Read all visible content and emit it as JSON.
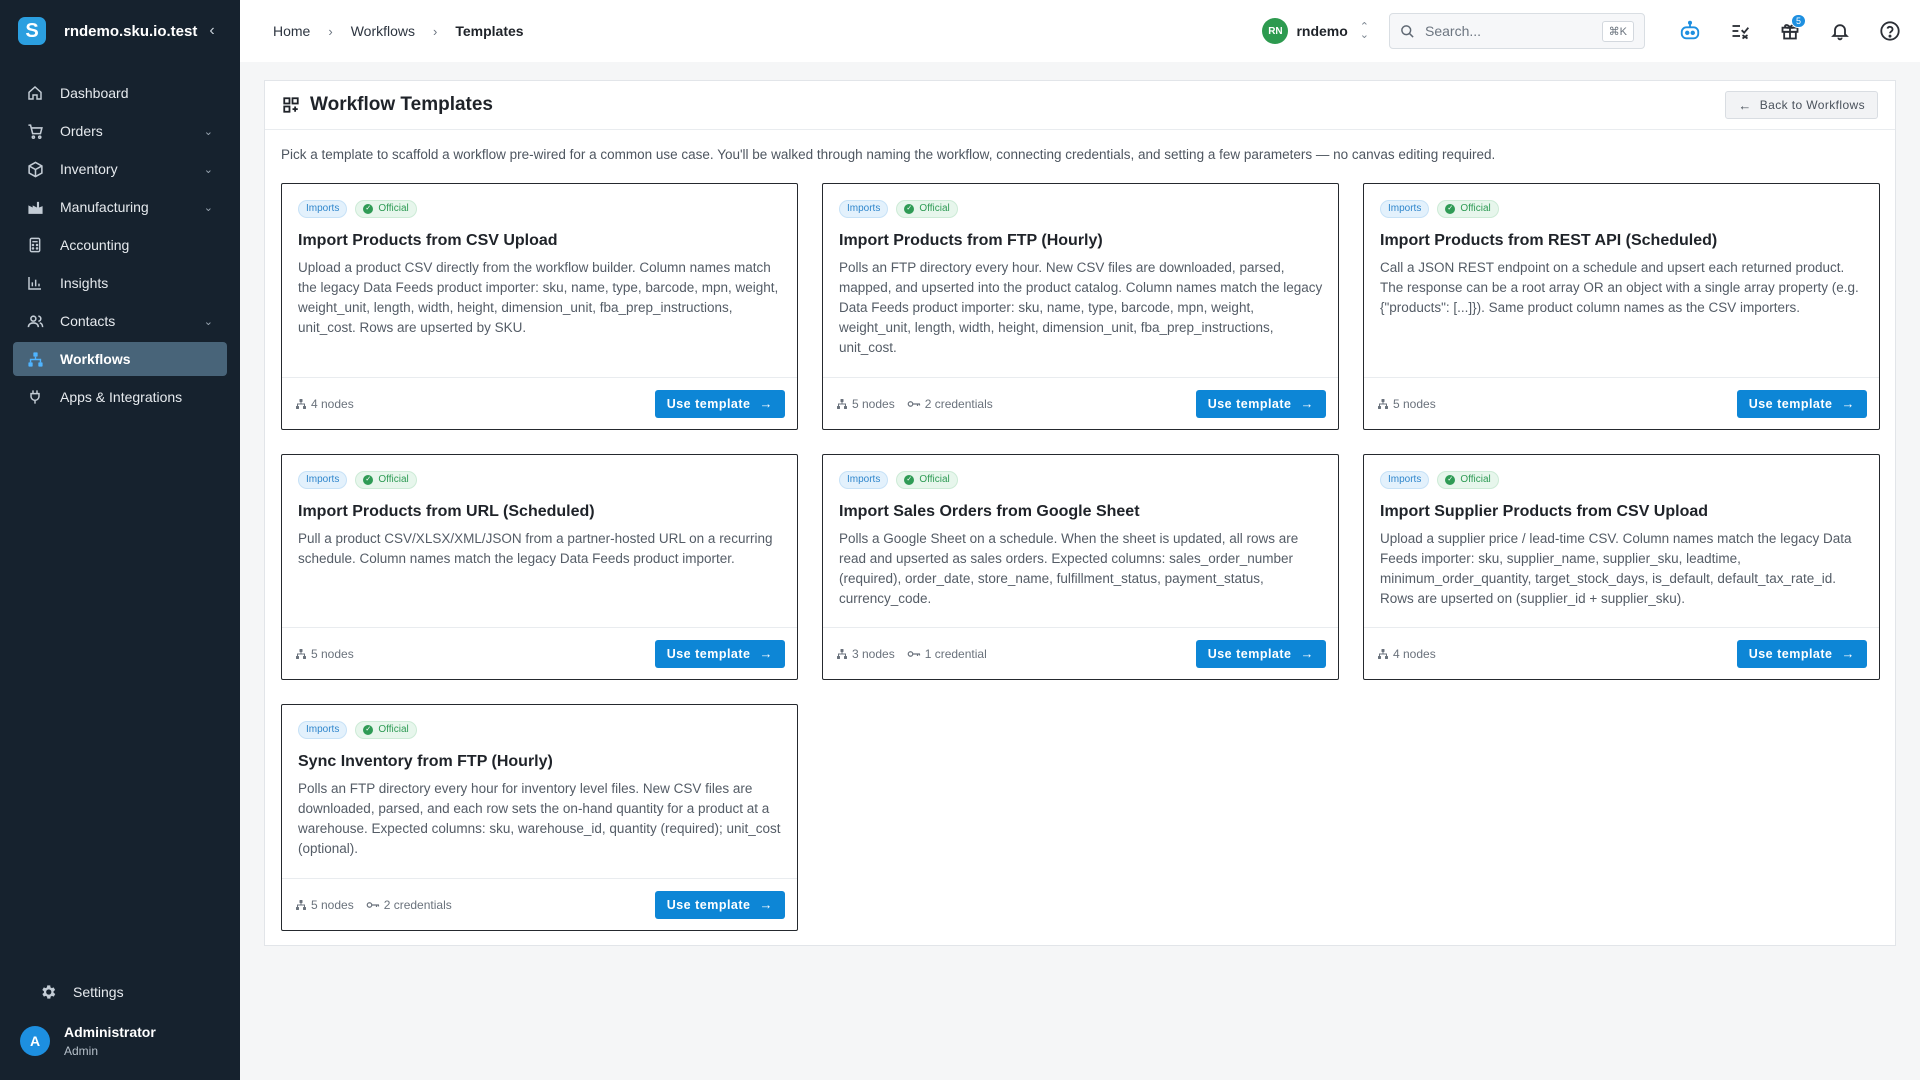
{
  "brand": {
    "logo_letter": "S",
    "name": "rndemo.sku.io.test",
    "collapse_glyph": "‹"
  },
  "sidebar": {
    "items": [
      {
        "label": "Dashboard",
        "icon": "home-icon",
        "expandable": false,
        "active": false
      },
      {
        "label": "Orders",
        "icon": "cart-icon",
        "expandable": true,
        "active": false
      },
      {
        "label": "Inventory",
        "icon": "box-icon",
        "expandable": true,
        "active": false
      },
      {
        "label": "Manufacturing",
        "icon": "factory-icon",
        "expandable": true,
        "active": false
      },
      {
        "label": "Accounting",
        "icon": "calculator-icon",
        "expandable": false,
        "active": false
      },
      {
        "label": "Insights",
        "icon": "chart-icon",
        "expandable": false,
        "active": false
      },
      {
        "label": "Contacts",
        "icon": "users-icon",
        "expandable": true,
        "active": false
      },
      {
        "label": "Workflows",
        "icon": "workflow-icon",
        "expandable": false,
        "active": true
      },
      {
        "label": "Apps & Integrations",
        "icon": "plug-icon",
        "expandable": false,
        "active": false
      }
    ],
    "settings_label": "Settings",
    "user": {
      "initial": "A",
      "name": "Administrator",
      "role": "Admin"
    }
  },
  "breadcrumb": {
    "home": "Home",
    "workflows": "Workflows",
    "current": "Templates"
  },
  "topbar": {
    "org": {
      "initials": "RN",
      "name": "rndemo"
    },
    "search": {
      "placeholder": "Search...",
      "shortcut": "⌘K"
    },
    "gift_badge": "5"
  },
  "page": {
    "title": "Workflow Templates",
    "back_label": "Back to Workflows",
    "intro": "Pick a template to scaffold a workflow pre-wired for a common use case. You'll be walked through naming the workflow, connecting credentials, and setting a few parameters — no canvas editing required.",
    "use_label": "Use template"
  },
  "templates": [
    {
      "category": "Imports",
      "official": "Official",
      "title": "Import Products from CSV Upload",
      "description": "Upload a product CSV directly from the workflow builder. Column names match the legacy Data Feeds product importer: sku, name, type, barcode, mpn, weight, weight_unit, length, width, height, dimension_unit, fba_prep_instructions, unit_cost. Rows are upserted by SKU.",
      "nodes": "4 nodes",
      "credentials": ""
    },
    {
      "category": "Imports",
      "official": "Official",
      "title": "Import Products from FTP (Hourly)",
      "description": "Polls an FTP directory every hour. New CSV files are downloaded, parsed, mapped, and upserted into the product catalog. Column names match the legacy Data Feeds product importer: sku, name, type, barcode, mpn, weight, weight_unit, length, width, height, dimension_unit, fba_prep_instructions, unit_cost.",
      "nodes": "5 nodes",
      "credentials": "2 credentials"
    },
    {
      "category": "Imports",
      "official": "Official",
      "title": "Import Products from REST API (Scheduled)",
      "description": "Call a JSON REST endpoint on a schedule and upsert each returned product. The response can be a root array OR an object with a single array property (e.g. {\"products\": [...]}). Same product column names as the CSV importers.",
      "nodes": "5 nodes",
      "credentials": ""
    },
    {
      "category": "Imports",
      "official": "Official",
      "title": "Import Products from URL (Scheduled)",
      "description": "Pull a product CSV/XLSX/XML/JSON from a partner-hosted URL on a recurring schedule. Column names match the legacy Data Feeds product importer.",
      "nodes": "5 nodes",
      "credentials": ""
    },
    {
      "category": "Imports",
      "official": "Official",
      "title": "Import Sales Orders from Google Sheet",
      "description": "Polls a Google Sheet on a schedule. When the sheet is updated, all rows are read and upserted as sales orders. Expected columns: sales_order_number (required), order_date, store_name, fulfillment_status, payment_status, currency_code.",
      "nodes": "3 nodes",
      "credentials": "1 credential"
    },
    {
      "category": "Imports",
      "official": "Official",
      "title": "Import Supplier Products from CSV Upload",
      "description": "Upload a supplier price / lead-time CSV. Column names match the legacy Data Feeds importer: sku, supplier_name, supplier_sku, leadtime, minimum_order_quantity, target_stock_days, is_default, default_tax_rate_id. Rows are upserted on (supplier_id + supplier_sku).",
      "nodes": "4 nodes",
      "credentials": ""
    },
    {
      "category": "Imports",
      "official": "Official",
      "title": "Sync Inventory from FTP (Hourly)",
      "description": "Polls an FTP directory every hour for inventory level files. New CSV files are downloaded, parsed, and each row sets the on-hand quantity for a product at a warehouse. Expected columns: sku, warehouse_id, quantity (required); unit_cost (optional).",
      "nodes": "5 nodes",
      "credentials": "2 credentials"
    }
  ]
}
